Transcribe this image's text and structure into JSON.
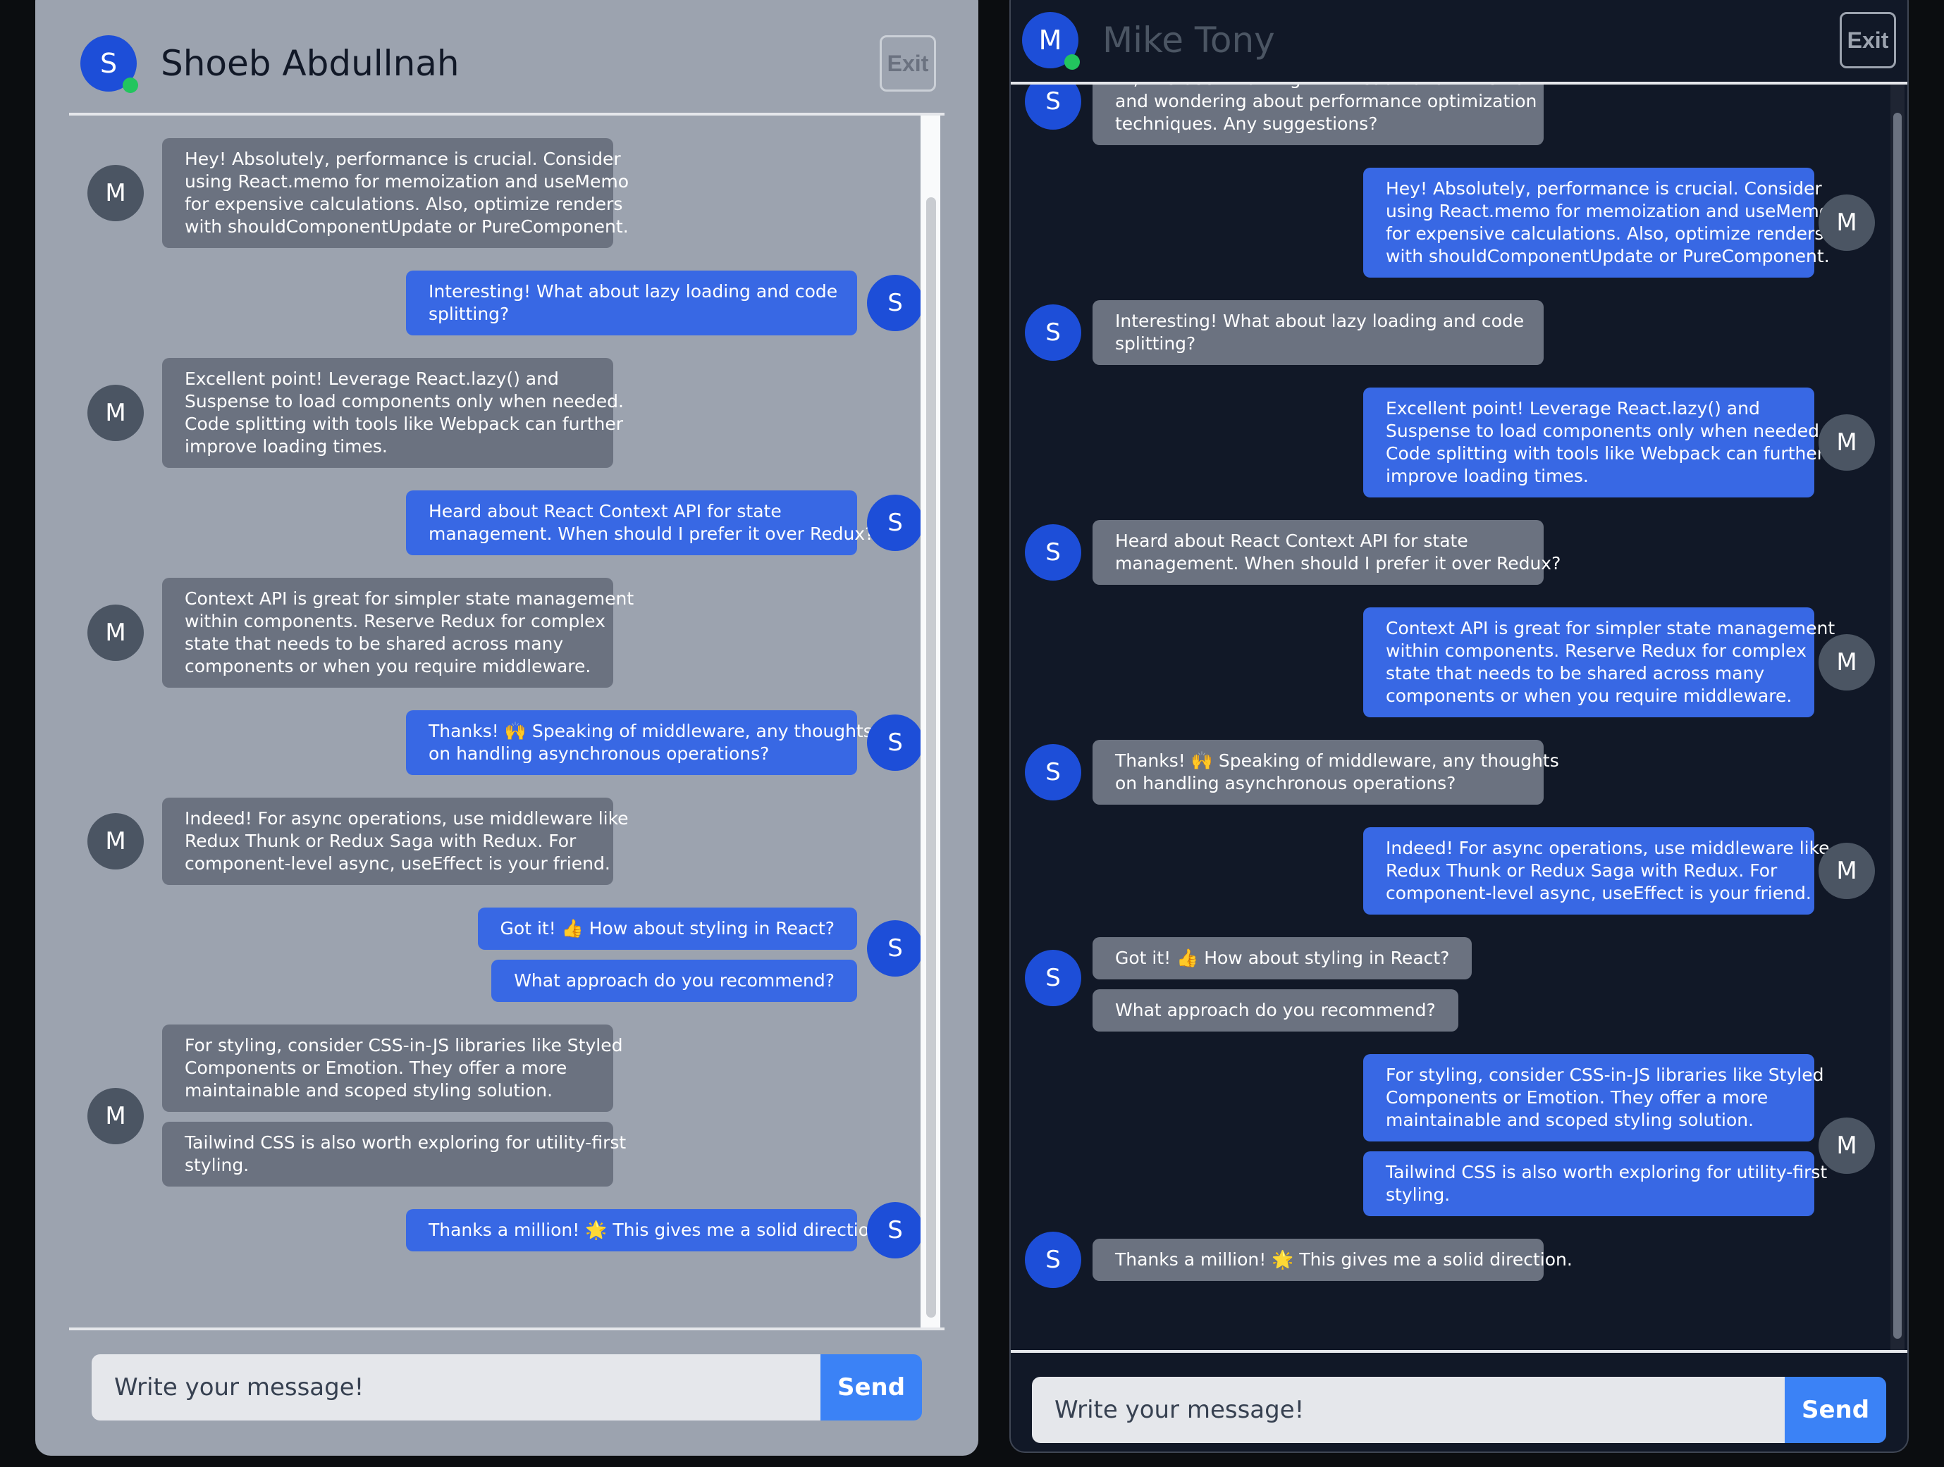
{
  "left_chat": {
    "header": {
      "avatar_letter": "S",
      "name": "Shoeb Abdullnah",
      "exit_label": "Exit"
    },
    "input": {
      "placeholder": "Write your message!",
      "send_label": "Send"
    },
    "messages": [
      {
        "sender": "M",
        "side": "left",
        "lines": [
          "Hey! Absolutely, performance is crucial. Consider",
          "using React.memo for memoization and useMemo",
          "for expensive calculations. Also, optimize renders",
          "with shouldComponentUpdate or PureComponent."
        ]
      },
      {
        "sender": "S",
        "side": "right",
        "lines": [
          "Interesting! What about lazy loading and code",
          "splitting?"
        ]
      },
      {
        "sender": "M",
        "side": "left",
        "lines": [
          "Excellent point! Leverage React.lazy() and",
          "Suspense to load components only when needed.",
          "Code splitting with tools like Webpack can further",
          "improve loading times."
        ]
      },
      {
        "sender": "S",
        "side": "right",
        "lines": [
          "Heard about React Context API for state",
          "management. When should I prefer it over Redux?"
        ]
      },
      {
        "sender": "M",
        "side": "left",
        "lines": [
          "Context API is great for simpler state management",
          "within components. Reserve Redux for complex",
          "state that needs to be shared across many",
          "components or when you require middleware."
        ]
      },
      {
        "sender": "S",
        "side": "right",
        "lines": [
          "Thanks! 🙌 Speaking of middleware, any thoughts",
          "on handling asynchronous operations?"
        ]
      },
      {
        "sender": "M",
        "side": "left",
        "lines": [
          "Indeed! For async operations, use middleware like",
          "Redux Thunk or Redux Saga with Redux. For",
          "component-level async, useEffect is your friend."
        ]
      },
      {
        "sender": "S",
        "side": "right",
        "lines": [
          "Got it! 👍 How about styling in React?"
        ]
      },
      {
        "sender": "S",
        "side": "right",
        "lines": [
          "What approach do you recommend?"
        ]
      },
      {
        "sender": "M",
        "side": "left",
        "lines": [
          "For styling, consider CSS-in-JS libraries like Styled",
          "Components or Emotion. They offer a more",
          "maintainable and scoped styling solution."
        ]
      },
      {
        "sender": "M",
        "side": "left",
        "lines": [
          "Tailwind CSS is also worth exploring for utility-first",
          "styling."
        ]
      },
      {
        "sender": "S",
        "side": "right",
        "lines": [
          "Thanks a million! 🌟 This gives me a solid direction."
        ]
      }
    ]
  },
  "right_chat": {
    "header": {
      "avatar_letter": "M",
      "name": "Mike Tony",
      "exit_label": "Exit"
    },
    "input": {
      "placeholder": "Write your message!",
      "send_label": "Send"
    },
    "messages": [
      {
        "sender": "S",
        "side": "left",
        "lines": [
          "Hi, I've been working with React for a while now",
          "and wondering about performance optimization",
          "techniques. Any suggestions?"
        ]
      },
      {
        "sender": "M",
        "side": "right",
        "lines": [
          "Hey! Absolutely, performance is crucial. Consider",
          "using React.memo for memoization and useMemo",
          "for expensive calculations. Also, optimize renders",
          "with shouldComponentUpdate or PureComponent."
        ]
      },
      {
        "sender": "S",
        "side": "left",
        "lines": [
          "Interesting! What about lazy loading and code",
          "splitting?"
        ]
      },
      {
        "sender": "M",
        "side": "right",
        "lines": [
          "Excellent point! Leverage React.lazy() and",
          "Suspense to load components only when needed.",
          "Code splitting with tools like Webpack can further",
          "improve loading times."
        ]
      },
      {
        "sender": "S",
        "side": "left",
        "lines": [
          "Heard about React Context API for state",
          "management. When should I prefer it over Redux?"
        ]
      },
      {
        "sender": "M",
        "side": "right",
        "lines": [
          "Context API is great for simpler state management",
          "within components. Reserve Redux for complex",
          "state that needs to be shared across many",
          "components or when you require middleware."
        ]
      },
      {
        "sender": "S",
        "side": "left",
        "lines": [
          "Thanks! 🙌 Speaking of middleware, any thoughts",
          "on handling asynchronous operations?"
        ]
      },
      {
        "sender": "M",
        "side": "right",
        "lines": [
          "Indeed! For async operations, use middleware like",
          "Redux Thunk or Redux Saga with Redux. For",
          "component-level async, useEffect is your friend."
        ]
      },
      {
        "sender": "S",
        "side": "left",
        "lines": [
          "Got it! 👍 How about styling in React?"
        ]
      },
      {
        "sender": "S",
        "side": "left",
        "lines": [
          "What approach do you recommend?"
        ]
      },
      {
        "sender": "M",
        "side": "right",
        "lines": [
          "For styling, consider CSS-in-JS libraries like Styled",
          "Components or Emotion. They offer a more",
          "maintainable and scoped styling solution."
        ]
      },
      {
        "sender": "M",
        "side": "right",
        "lines": [
          "Tailwind CSS is also worth exploring for utility-first",
          "styling."
        ]
      },
      {
        "sender": "S",
        "side": "left",
        "lines": [
          "Thanks a million! 🌟 This gives me a solid direction."
        ]
      }
    ]
  },
  "colors": {
    "sent_bubble": "#3868e4",
    "received_bubble": "#6b7280",
    "avatar_blue": "#1d4ed8",
    "avatar_gray": "#4b5563",
    "send_button": "#3b82f6",
    "online": "#22c55e"
  }
}
